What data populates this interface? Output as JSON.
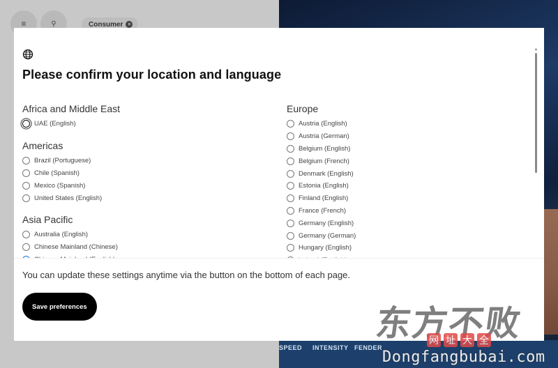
{
  "background": {
    "consumer_chip": "Consumer",
    "chip_close_glyph": "×",
    "menu_glyph": "≡",
    "search_glyph": "🔍",
    "dash_labels": [
      "SPEED",
      "INTENSITY",
      "FENDER"
    ]
  },
  "modal": {
    "title": "Please confirm your location and language",
    "left_column": [
      {
        "region": "Africa and Middle East",
        "options": [
          {
            "label": "UAE (English)",
            "state": "focused"
          }
        ]
      },
      {
        "region": "Americas",
        "options": [
          {
            "label": "Brazil (Portuguese)"
          },
          {
            "label": "Chile (Spanish)"
          },
          {
            "label": "Mexico (Spanish)"
          },
          {
            "label": "United States (English)"
          }
        ]
      },
      {
        "region": "Asia Pacific",
        "options": [
          {
            "label": "Australia (English)"
          },
          {
            "label": "Chinese Mainland (Chinese)"
          },
          {
            "label": "Chinese Mainland (English)",
            "state": "checked"
          }
        ]
      }
    ],
    "right_column": [
      {
        "region": "Europe",
        "options": [
          {
            "label": "Austria (English)"
          },
          {
            "label": "Austria (German)"
          },
          {
            "label": "Belgium (English)"
          },
          {
            "label": "Belgium (French)"
          },
          {
            "label": "Denmark (English)"
          },
          {
            "label": "Estonia (English)"
          },
          {
            "label": "Finland (English)"
          },
          {
            "label": "France (French)"
          },
          {
            "label": "Germany (English)"
          },
          {
            "label": "Germany (German)"
          },
          {
            "label": "Hungary (English)"
          },
          {
            "label": "Ireland (English)"
          }
        ]
      }
    ],
    "note": "You can update these settings anytime via the button on the bottom of each page.",
    "save_label": "Save preferences"
  },
  "watermark": {
    "chinese": "东方不败",
    "small": [
      "网",
      "址",
      "大",
      "全"
    ],
    "url": "Dongfangbubai.com"
  },
  "colors": {
    "accent": "#1a73e8",
    "button": "#000000"
  }
}
